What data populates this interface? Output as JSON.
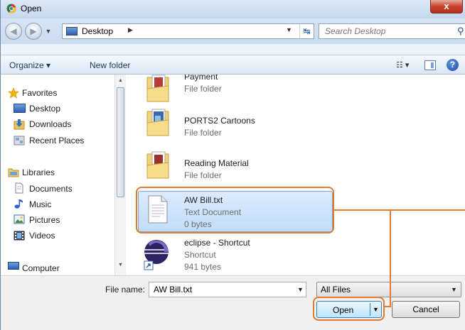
{
  "window": {
    "title": "Open",
    "close_glyph": "x"
  },
  "address_bar": {
    "location": "Desktop",
    "search_placeholder": "Search Desktop"
  },
  "command_bar": {
    "organize_label": "Organize ▾",
    "new_folder_label": "New folder",
    "help_glyph": "?"
  },
  "nav_pane": {
    "favorites_header": "Favorites",
    "favorites": [
      "Desktop",
      "Downloads",
      "Recent Places"
    ],
    "libraries_header": "Libraries",
    "libraries": [
      "Documents",
      "Music",
      "Pictures",
      "Videos"
    ],
    "computer_header": "Computer"
  },
  "files": [
    {
      "name": "Payment",
      "type": "File folder",
      "size": ""
    },
    {
      "name": "PORTS2 Cartoons",
      "type": "File folder",
      "size": ""
    },
    {
      "name": "Reading Material",
      "type": "File folder",
      "size": ""
    },
    {
      "name": "AW Bill.txt",
      "type": "Text Document",
      "size": "0 bytes",
      "selected": true
    },
    {
      "name": "eclipse - Shortcut",
      "type": "Shortcut",
      "size": "941 bytes"
    }
  ],
  "bottom": {
    "file_name_label": "File name:",
    "file_name_value": "AW Bill.txt",
    "file_type_filter": "All Files",
    "open_label": "Open",
    "cancel_label": "Cancel"
  },
  "colors": {
    "highlight": "#e07a2f",
    "selection": "#cce4fc"
  }
}
